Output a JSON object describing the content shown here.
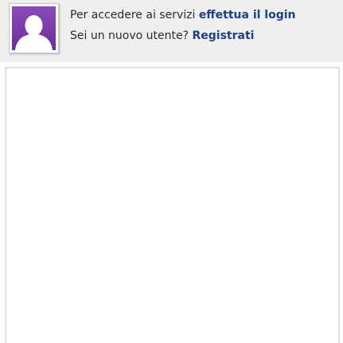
{
  "login_bar": {
    "avatar": {
      "icon": "user-silhouette-icon",
      "background_color": "#7a3ca7",
      "silhouette_color": "#ffffff"
    },
    "line1_text": "Per accedere ai servizi",
    "line1_link": "effettua il login",
    "line2_text": "Sei un nuovo utente?",
    "line2_link": "Registrati"
  },
  "colors": {
    "bar_background": "#efefef",
    "link": "#1f3f86",
    "text": "#2b2b2b",
    "content_border": "#e1e1e1"
  }
}
